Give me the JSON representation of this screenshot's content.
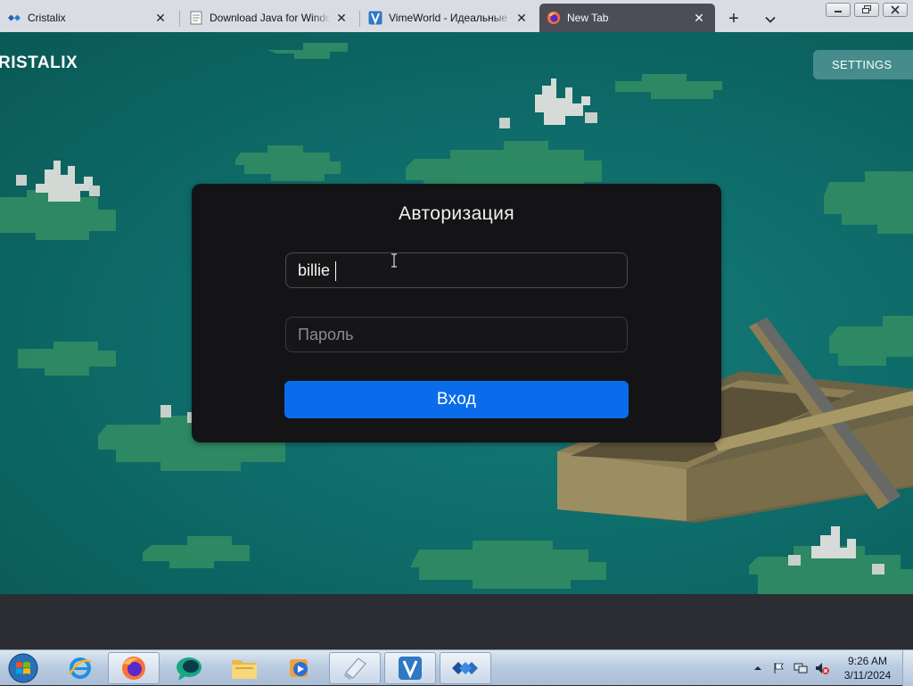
{
  "browser": {
    "tabs": [
      {
        "title": "Cristalix",
        "icon": "cristalix-icon",
        "active": false
      },
      {
        "title": "Download Java for Windows",
        "icon": "java-page-icon",
        "active": false
      },
      {
        "title": "VimeWorld - Идеальные с",
        "icon": "vimeworld-icon",
        "active": false
      },
      {
        "title": "New Tab",
        "icon": "firefox-icon",
        "active": true
      }
    ],
    "new_tab_label": "+"
  },
  "page": {
    "brand": "RISTALIX",
    "settings_label": "SETTINGS",
    "auth": {
      "title": "Авторизация",
      "login_value": "billie",
      "password_placeholder": "Пароль",
      "submit_label": "Вход"
    }
  },
  "taskbar": {
    "pinned": [
      {
        "name": "internet-explorer",
        "icon": "internet-explorer-icon",
        "running": false
      },
      {
        "name": "firefox",
        "icon": "firefox-icon",
        "running": true
      },
      {
        "name": "messenger",
        "icon": "chat-bubble-icon",
        "running": false
      },
      {
        "name": "file-explorer",
        "icon": "folder-icon",
        "running": false
      },
      {
        "name": "media-player",
        "icon": "media-player-icon",
        "running": false
      },
      {
        "name": "java-installer",
        "icon": "installer-icon",
        "running": true
      },
      {
        "name": "vimeworld-launcher",
        "icon": "vimeworld-icon",
        "running": true
      },
      {
        "name": "cristalix-launcher",
        "icon": "cristalix-icon",
        "running": true
      }
    ],
    "clock_time": "9:26 AM",
    "clock_date": "3/11/2024"
  },
  "colors": {
    "accent": "#0a6cea",
    "card": "#141416",
    "water": "#0e6d6b",
    "active_tab": "#4c4d57"
  }
}
